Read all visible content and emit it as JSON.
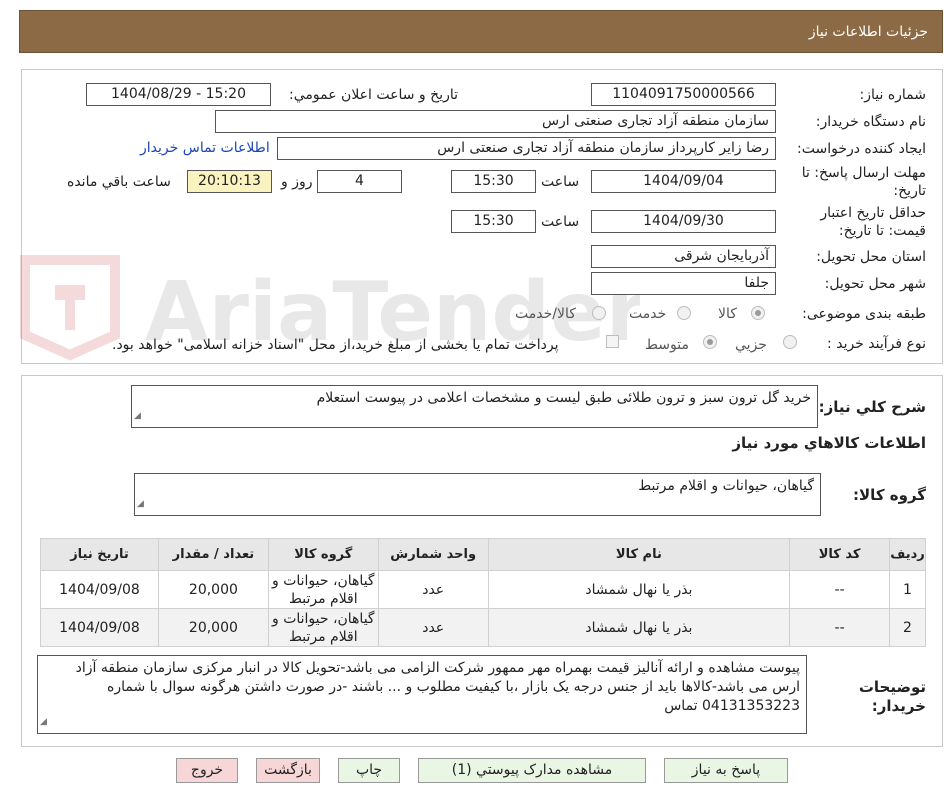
{
  "header": {
    "title": "جزئیات اطلاعات نیاز"
  },
  "fields": {
    "need_number_label": "شماره نیاز:",
    "need_number": "1104091750000566",
    "announce_label": "تاریخ و ساعت اعلان عمومي:",
    "announce_value": "1404/08/29 - 15:20",
    "buyer_org_label": "نام دستگاه خريدار:",
    "buyer_org": "سازمان منطقه آزاد تجاری صنعتی ارس",
    "creator_label": "ايجاد کننده درخواست:",
    "creator": "رضا زایر کارپرداز سازمان منطقه آزاد تجاری صنعتی ارس",
    "contact_link": "اطلاعات تماس خريدار",
    "deadline_label_1": "مهلت ارسال پاسخ: تا",
    "deadline_label_2": "تاريخ:",
    "deadline_date": "1404/09/04",
    "time_label": "ساعت",
    "deadline_time": "15:30",
    "days_value": "4",
    "days_label": "روز و",
    "remaining_time": "20:10:13",
    "remaining_label": "ساعت باقي مانده",
    "validity_label_1": "حداقل تاريخ اعتبار",
    "validity_label_2": "قيمت: تا تاريخ:",
    "validity_date": "1404/09/30",
    "validity_time": "15:30",
    "province_label": "استان محل تحويل:",
    "province": "آذربايجان شرقی",
    "city_label": "شهر محل تحويل:",
    "city": "جلفا",
    "category_label": "طبقه بندی موضوعی:",
    "category_options": [
      "کالا",
      "خدمت",
      "کالا/خدمت"
    ],
    "process_label": "نوع فرآيند خريد :",
    "process_options": [
      "جزيي",
      "متوسط"
    ],
    "payment_note": "پرداخت تمام يا بخشی از مبلغ خريد،از محل \"اسناد خزانه اسلامی\" خواهد بود."
  },
  "description": {
    "label": "شرح کلي نياز:",
    "value": "خرید گل ترون سبز و ترون طلائی طبق لیست و مشخصات اعلامی در پیوست استعلام"
  },
  "goods": {
    "section_title": "اطلاعات کالاهاي مورد نياز",
    "group_label": "گروه کالا:",
    "group_value": "گیاهان، حیوانات و اقلام مرتبط"
  },
  "table": {
    "headers": [
      "رديف",
      "کد کالا",
      "نام کالا",
      "واحد شمارش",
      "گروه کالا",
      "تعداد / مقدار",
      "تاريخ نياز"
    ],
    "rows": [
      {
        "row": "1",
        "code": "--",
        "name": "بذر یا نهال شمشاد",
        "unit": "عدد",
        "group": "گیاهان، حیوانات و اقلام مرتبط",
        "qty": "20,000",
        "date": "1404/09/08"
      },
      {
        "row": "2",
        "code": "--",
        "name": "بذر یا نهال شمشاد",
        "unit": "عدد",
        "group": "گیاهان، حیوانات و اقلام مرتبط",
        "qty": "20,000",
        "date": "1404/09/08"
      }
    ]
  },
  "buyer_notes": {
    "label_1": "توضيحات",
    "label_2": "خريدار:",
    "value": "پیوست مشاهده و ارائه آنالیز قیمت بهمراه مهر ممهور شرکت الزامی می باشد-تحویل کالا در انبار مرکزی سازمان منطقه آزاد ارس می باشد-کالاها باید از جنس درجه یک بازار ،با کیفیت مطلوب و ... باشند -در صورت داشتن هرگونه سوال با شماره 04131353223 تماس"
  },
  "buttons": {
    "reply": "پاسخ به نياز",
    "attachments": "مشاهده مدارک پيوستي (1)",
    "print": "چاپ",
    "back": "بازگشت",
    "exit": "خروج"
  },
  "watermark": {
    "text": "AriaTender.neT"
  },
  "colors": {
    "header": "#8b6a45",
    "highlight": "#fbf3bf",
    "link": "#1a46b8",
    "button": "#eaf6e4",
    "button_danger": "#f6d6d6"
  }
}
